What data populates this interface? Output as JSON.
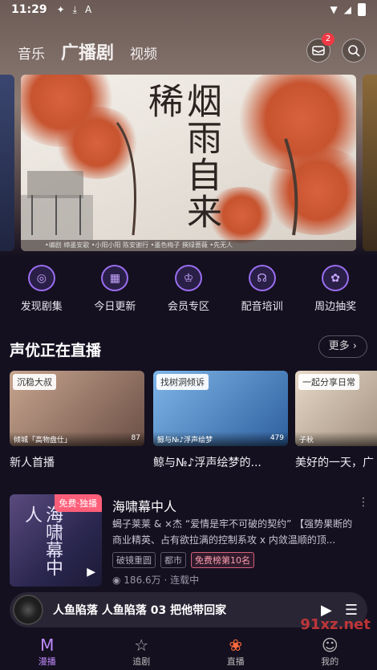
{
  "status": {
    "time": "11:29"
  },
  "topnav": {
    "tabs": [
      {
        "label": "音乐"
      },
      {
        "label": "广播剧"
      },
      {
        "label": "视频"
      }
    ],
    "message_badge": "2"
  },
  "banner": {
    "title": "烟雨自来稀",
    "strip": "•编剧 缔墨安歌   •小阳小阳 陈安谢行   •墨色梅子 撰绿蔷薇   •先无人"
  },
  "quick_actions": [
    {
      "label": "发现剧集",
      "icon": "discover-icon"
    },
    {
      "label": "今日更新",
      "icon": "calendar-icon"
    },
    {
      "label": "会员专区",
      "icon": "vip-icon"
    },
    {
      "label": "配音培训",
      "icon": "headset-icon"
    },
    {
      "label": "周边抽奖",
      "icon": "merch-icon"
    }
  ],
  "live": {
    "title": "声优正在直播",
    "more": "更多 ›",
    "items": [
      {
        "tag": "沉稳大叔",
        "bottom": "倾城「高物盘仕」",
        "count": "87",
        "caption": "新人首播",
        "gradient": "linear-gradient(135deg,#c7a58f,#6b4f45)"
      },
      {
        "tag": "找树洞倾诉",
        "bottom": "鲸与№♪浮声绘梦",
        "count": "479",
        "caption": "鲸与№♪浮声绘梦的...",
        "gradient": "linear-gradient(135deg,#7fb6e8,#2d5f9e)"
      },
      {
        "tag": "一起分享日常",
        "bottom": "子秋",
        "count": "",
        "caption": "美好的一天，广",
        "gradient": "linear-gradient(135deg,#e8d9c8,#8c7a68)"
      }
    ]
  },
  "drama": {
    "cover_title": "海啸幕中人",
    "badge": "免费·独播",
    "title": "海啸幕中人",
    "desc": "蝎子莱莱 & ×杰 “爱情是牢不可破的契约” 【强势果断的商业精英、占有欲拉满的控制系攻 x 内敛温顺的顶...",
    "tags": [
      "破镜重圆",
      "都市",
      "免费榜第10名"
    ],
    "meta": "186.6万 · 连载中"
  },
  "player": {
    "text": "人鱼陷落 人鱼陷落 03 把他带回家"
  },
  "bottom_nav": [
    {
      "label": "漫播",
      "icon": "home-icon"
    },
    {
      "label": "追剧",
      "icon": "star-icon"
    },
    {
      "label": "直播",
      "icon": "live-icon"
    },
    {
      "label": "我的",
      "icon": "profile-icon"
    }
  ],
  "watermark": "91xz.net"
}
